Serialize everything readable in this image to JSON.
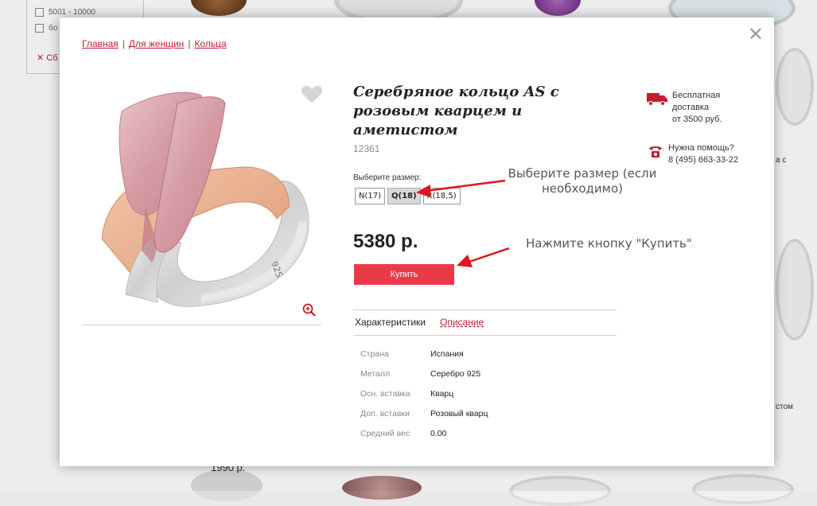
{
  "background": {
    "filter_options": [
      "5001 - 10000",
      "бо"
    ],
    "reset_label": "Сб",
    "side_texts": [
      "а с",
      "стом"
    ],
    "price_fragment": "1990 р."
  },
  "modal": {
    "close_icon": "close-icon",
    "breadcrumb": [
      "Главная",
      "Для женщин",
      "Кольца"
    ],
    "product": {
      "title": "Серебряное кольцо AS с розовым кварцем и аметистом",
      "sku": "12361",
      "size_label": "Выберите размер:",
      "sizes": [
        {
          "label": "N(17)",
          "selected": false
        },
        {
          "label": "Q(18)",
          "selected": true
        },
        {
          "label": "R(18,5)",
          "selected": false
        }
      ],
      "price": "5380 р.",
      "buy_label": "Купить"
    },
    "annotations": {
      "size_hint": "Выберите размер (если необходимо)",
      "buy_hint": "Нажмите кнопку \"Купить\""
    },
    "delivery": {
      "icon": "truck-icon",
      "lines": [
        "Бесплатная",
        "доставка",
        "от 3500 руб."
      ]
    },
    "help": {
      "icon": "phone-icon",
      "lines": [
        "Нужна помощь?",
        "8 (495) 663-33-22"
      ]
    },
    "tabs": [
      "Характеристики",
      "Описание"
    ],
    "specs": [
      {
        "key": "Страна",
        "value": "Испания"
      },
      {
        "key": "Металл",
        "value": "Серебро 925"
      },
      {
        "key": "Осн. вставка",
        "value": "Кварц"
      },
      {
        "key": "Доп. вставки",
        "value": "Розовый кварц"
      },
      {
        "key": "Средний вес",
        "value": "0.00"
      }
    ],
    "ring_engraving": "925",
    "colors": {
      "accent": "#ea3a4a",
      "link": "#c41d2e",
      "arrow": "#e0141e"
    }
  }
}
